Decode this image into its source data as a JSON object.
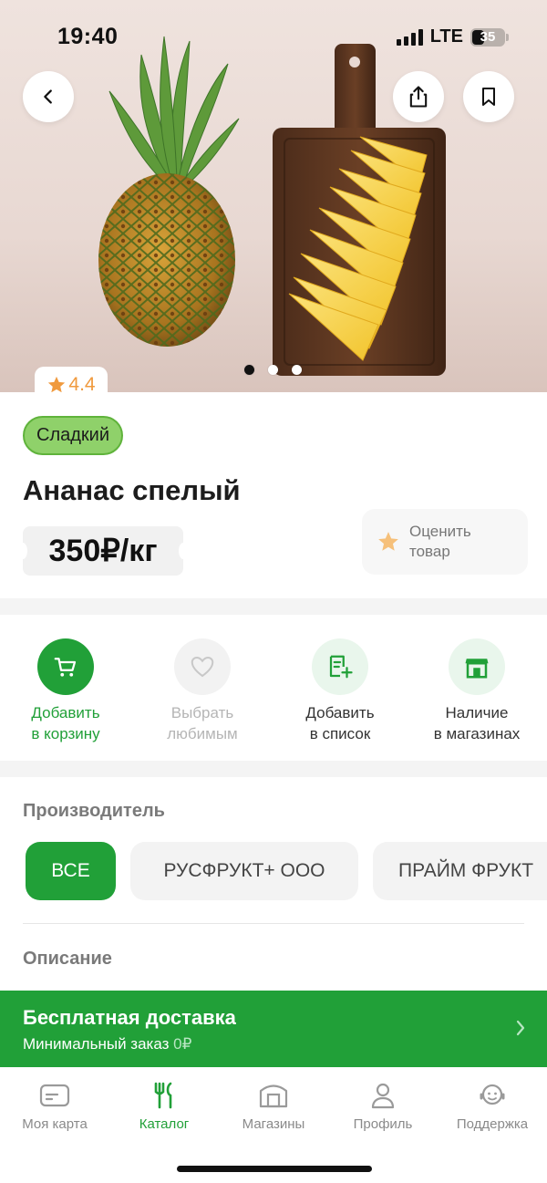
{
  "status_bar": {
    "time": "19:40",
    "network": "LTE",
    "battery": "35"
  },
  "hero": {
    "image_description_icon": "pineapple-photo",
    "slides_total": 3,
    "slide_active": 1,
    "rating": "4.4"
  },
  "product": {
    "tag": "Сладкий",
    "title": "Ананас спелый",
    "price": "350₽/кг",
    "rate_label_line1": "Оценить",
    "rate_label_line2": "товар"
  },
  "actions": [
    {
      "line1": "Добавить",
      "line2": "в корзину",
      "icon": "cart-icon",
      "color": "#21a038"
    },
    {
      "line1": "Выбрать",
      "line2": "любимым",
      "icon": "heart-icon",
      "color": "#b5b5b5"
    },
    {
      "line1": "Добавить",
      "line2": "в список",
      "icon": "list-add-icon",
      "color": "#333333"
    },
    {
      "line1": "Наличие",
      "line2": "в магазинах",
      "icon": "store-icon",
      "color": "#333333"
    }
  ],
  "manufacturer": {
    "title": "Производитель",
    "chips": [
      "ВСЕ",
      "РУСФРУКТ+ ООО",
      "ПРАЙМ ФРУКТ"
    ]
  },
  "description": {
    "title": "Описание"
  },
  "delivery_banner": {
    "title": "Бесплатная доставка",
    "subtitle": "Минимальный заказ",
    "amount": "0₽"
  },
  "tabbar": [
    {
      "label": "Моя карта",
      "icon": "card-icon"
    },
    {
      "label": "Каталог",
      "icon": "catalog-icon"
    },
    {
      "label": "Магазины",
      "icon": "store-icon"
    },
    {
      "label": "Профиль",
      "icon": "profile-icon"
    },
    {
      "label": "Поддержка",
      "icon": "support-icon"
    }
  ],
  "colors": {
    "brand_green": "#21a038",
    "tag_green": "#8fd16a",
    "rating_orange": "#f09a3e"
  }
}
